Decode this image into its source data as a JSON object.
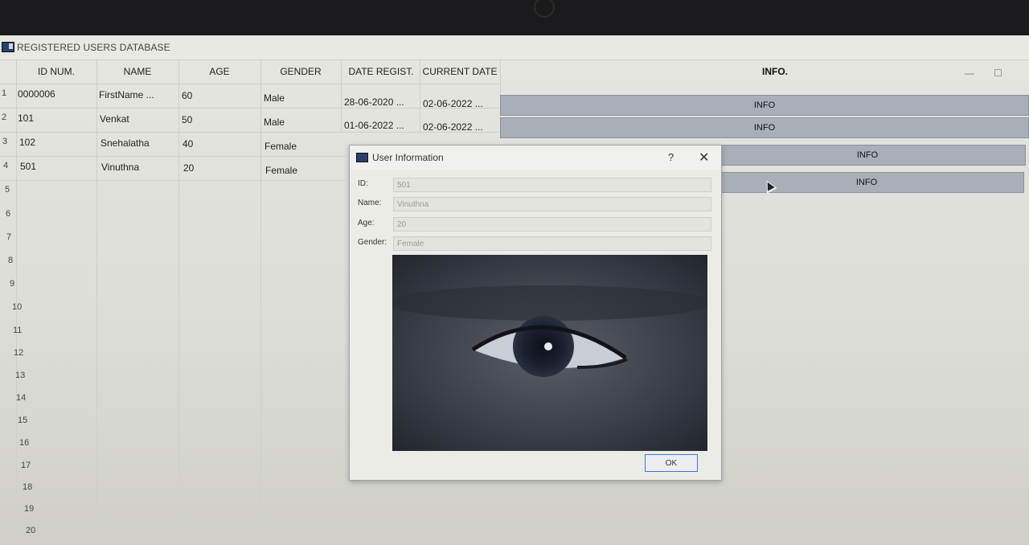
{
  "window": {
    "title": "REGISTERED USERS DATABASE",
    "minimize_glyph": "—",
    "maximize_glyph": "☐"
  },
  "table": {
    "headers": [
      "ID NUM.",
      "NAME",
      "AGE",
      "GENDER",
      "DATE REGIST.",
      "CURRENT DATE",
      "INFO."
    ],
    "rows": [
      {
        "num": "1",
        "id": "0000006",
        "name": "FirstName ...",
        "age": "60",
        "gender": "Male",
        "date_regist": "28-06-2020 ...",
        "current_date": "02-06-2022 ...",
        "info": "INFO"
      },
      {
        "num": "2",
        "id": "101",
        "name": "Venkat",
        "age": "50",
        "gender": "Male",
        "date_regist": "01-06-2022 ...",
        "current_date": "02-06-2022 ...",
        "info": "INFO"
      },
      {
        "num": "3",
        "id": "102",
        "name": "Snehalatha",
        "age": "40",
        "gender": "Female",
        "date_regist": "",
        "current_date": "",
        "info": "INFO"
      },
      {
        "num": "4",
        "id": "501",
        "name": "Vinuthna",
        "age": "20",
        "gender": "Female",
        "date_regist": "",
        "current_date": "",
        "info": "INFO"
      }
    ],
    "empty_rows": [
      "5",
      "6",
      "7",
      "8",
      "9",
      "10",
      "11",
      "12",
      "13",
      "14",
      "15",
      "16",
      "17",
      "18",
      "19",
      "20"
    ]
  },
  "dialog": {
    "title": "User Information",
    "help": "?",
    "close": "✕",
    "fields": [
      {
        "label": "ID:",
        "value": "501"
      },
      {
        "label": "Name:",
        "value": "Vinuthna"
      },
      {
        "label": "Age:",
        "value": "20"
      },
      {
        "label": "Gender:",
        "value": "Female"
      }
    ],
    "ok_label": "OK"
  },
  "colors": {
    "info_button": "#a9afb9",
    "ok_border": "#3d7bd6",
    "title_icon": "#2a3f6e"
  }
}
